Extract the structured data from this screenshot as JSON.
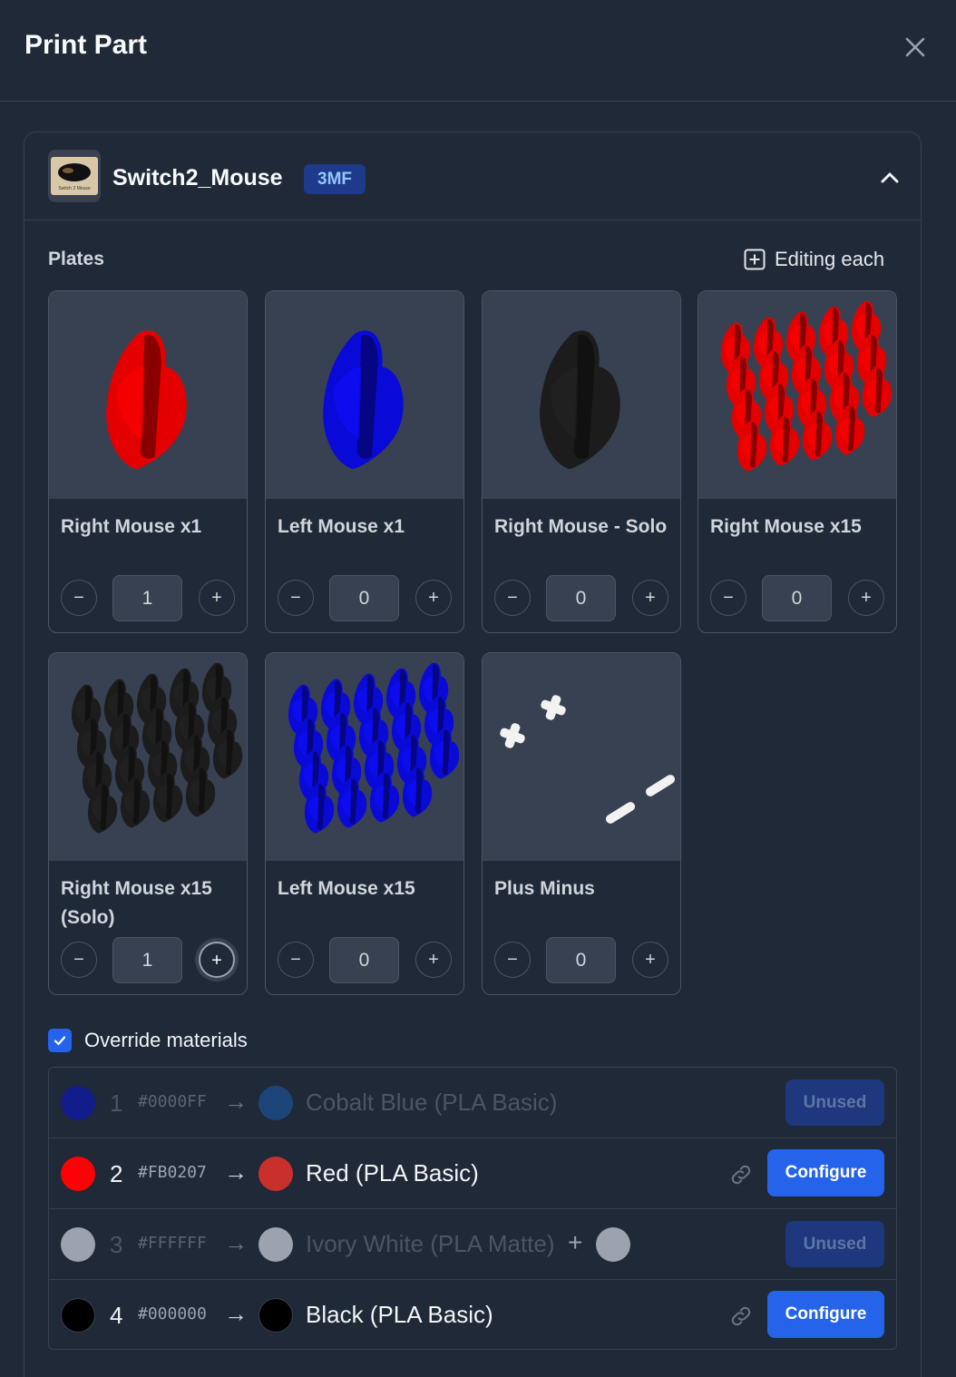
{
  "header": {
    "title": "Print Part"
  },
  "part": {
    "name": "Switch2_Mouse",
    "format_badge": "3MF",
    "thumb_caption": "Switch 2 Mouse"
  },
  "plates_section": {
    "label": "Plates",
    "editing_label": "Editing each"
  },
  "plates": [
    {
      "name": "Right Mouse x1",
      "quantity": "1",
      "color": "#e50000",
      "shape": "single"
    },
    {
      "name": "Left Mouse x1",
      "quantity": "0",
      "color": "#0a0ad8",
      "shape": "single"
    },
    {
      "name": "Right Mouse - Solo",
      "quantity": "0",
      "color": "#1c1c1c",
      "shape": "single"
    },
    {
      "name": "Right Mouse x15",
      "quantity": "0",
      "color": "#e50000",
      "shape": "grid"
    },
    {
      "name": "Right Mouse x15 (Solo)",
      "quantity": "1",
      "color": "#1c1c1c",
      "shape": "grid"
    },
    {
      "name": "Left Mouse x15",
      "quantity": "0",
      "color": "#0a0ad8",
      "shape": "grid"
    },
    {
      "name": "Plus Minus",
      "quantity": "0",
      "color": "#f2f2f2",
      "shape": "plusminus"
    }
  ],
  "override": {
    "label": "Override materials",
    "checked": true
  },
  "materials": [
    {
      "index": "1",
      "hex": "#0000FF",
      "src_color": "#0f1aa8",
      "dst_color": "#1e4f91",
      "name": "Cobalt Blue (PLA Basic)",
      "action": "Unused",
      "used": false
    },
    {
      "index": "2",
      "hex": "#FB0207",
      "src_color": "#fb0207",
      "dst_color": "#c9302c",
      "name": "Red (PLA Basic)",
      "action": "Configure",
      "used": true
    },
    {
      "index": "3",
      "hex": "#FFFFFF",
      "src_color": "#9ca3af",
      "dst_color": "#9ca3af",
      "extra_color": "#9ca3af",
      "name": "Ivory White (PLA Matte)",
      "action": "Unused",
      "used": false
    },
    {
      "index": "4",
      "hex": "#000000",
      "src_color": "#000000",
      "dst_color": "#000000",
      "name": "Black (PLA Basic)",
      "action": "Configure",
      "used": true
    }
  ],
  "symbols": {
    "arrow": "→",
    "plus": "+"
  },
  "icons": {
    "close": "close-icon",
    "collapse": "chevron-up-icon",
    "editing": "plus-square-icon",
    "link": "link-icon",
    "check": "check-icon",
    "stepper_minus": "−",
    "stepper_plus": "+"
  }
}
